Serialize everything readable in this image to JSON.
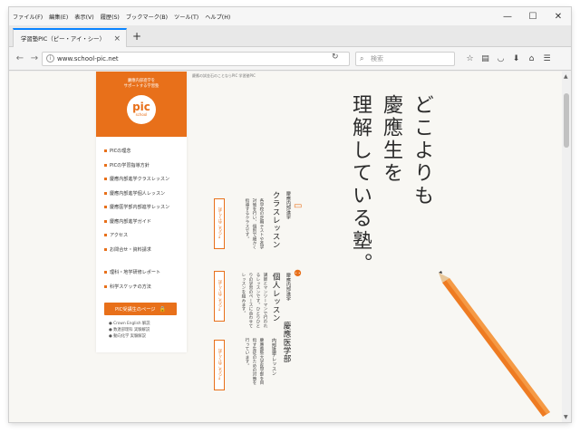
{
  "menubar": {
    "items": [
      "ファイル(F)",
      "編集(E)",
      "表示(V)",
      "履歴(S)",
      "ブックマーク(B)",
      "ツール(T)",
      "ヘルプ(H)"
    ]
  },
  "window_controls": {
    "minimize": "—",
    "maximize": "☐",
    "close": "✕"
  },
  "tab": {
    "title": "学習塾PIC（ピー・アイ・シー）",
    "close": "×",
    "new": "+"
  },
  "navbar": {
    "url": "www.school-pic.net",
    "search_placeholder": "検索",
    "icons": [
      "star-icon",
      "library-icon",
      "pocket-icon",
      "download-icon",
      "home-icon",
      "menu-icon"
    ]
  },
  "sidebar": {
    "tagline_1": "慶應内部進学を",
    "tagline_2": "サポートする学習塾",
    "logo_main": "pic",
    "logo_sub": "school",
    "menu_items": [
      "PICの理念",
      "PICの学習指導方針",
      "慶應内部進学クラスレッスン",
      "慶應内部進学個人レッスン",
      "慶應医学部内部進学レッスン",
      "慶應内部進学ガイド",
      "アクセス",
      "お問合せ・資料請求"
    ],
    "menu_items_2": [
      "理科・地学研修レポート",
      "科学スケッチの方法"
    ],
    "student_button": "PIC受講生のページ",
    "links": [
      "Crown English 解説",
      "数連部理科 実験解説",
      "動向化学 実験解説"
    ]
  },
  "breadcrumb": "慶應の試金石のことならPIC 学習塾PIC",
  "hero": {
    "line1": "どこよりも",
    "line2": "慶應生を",
    "line3": "理解している塾。"
  },
  "courses": [
    {
      "sub": "慶應内部進学",
      "title": "クラスレッスン",
      "desc": "各学校の定期テストや進学対策を行い、個別で細かく指導するクラスです。",
      "button": "詳しくはこちら"
    },
    {
      "sub": "慶應内部進学",
      "title": "個人レッスン",
      "desc": "講師とマンツーマンで行われるレッスンです。ひとりひとりの学習のペースに合わせてレッスンを組みます。",
      "button": "詳しくはこちら"
    },
    {
      "sub": "内部進学レッスン",
      "title": "慶應医学部",
      "desc": "慶應義塾大学医学部を目指す生徒のための対策を行っています。",
      "button": "詳しくはこちら"
    }
  ],
  "colors": {
    "accent": "#e8701a",
    "page_bg": "#f8f7f3",
    "tab_highlight": "#0a84ff"
  }
}
